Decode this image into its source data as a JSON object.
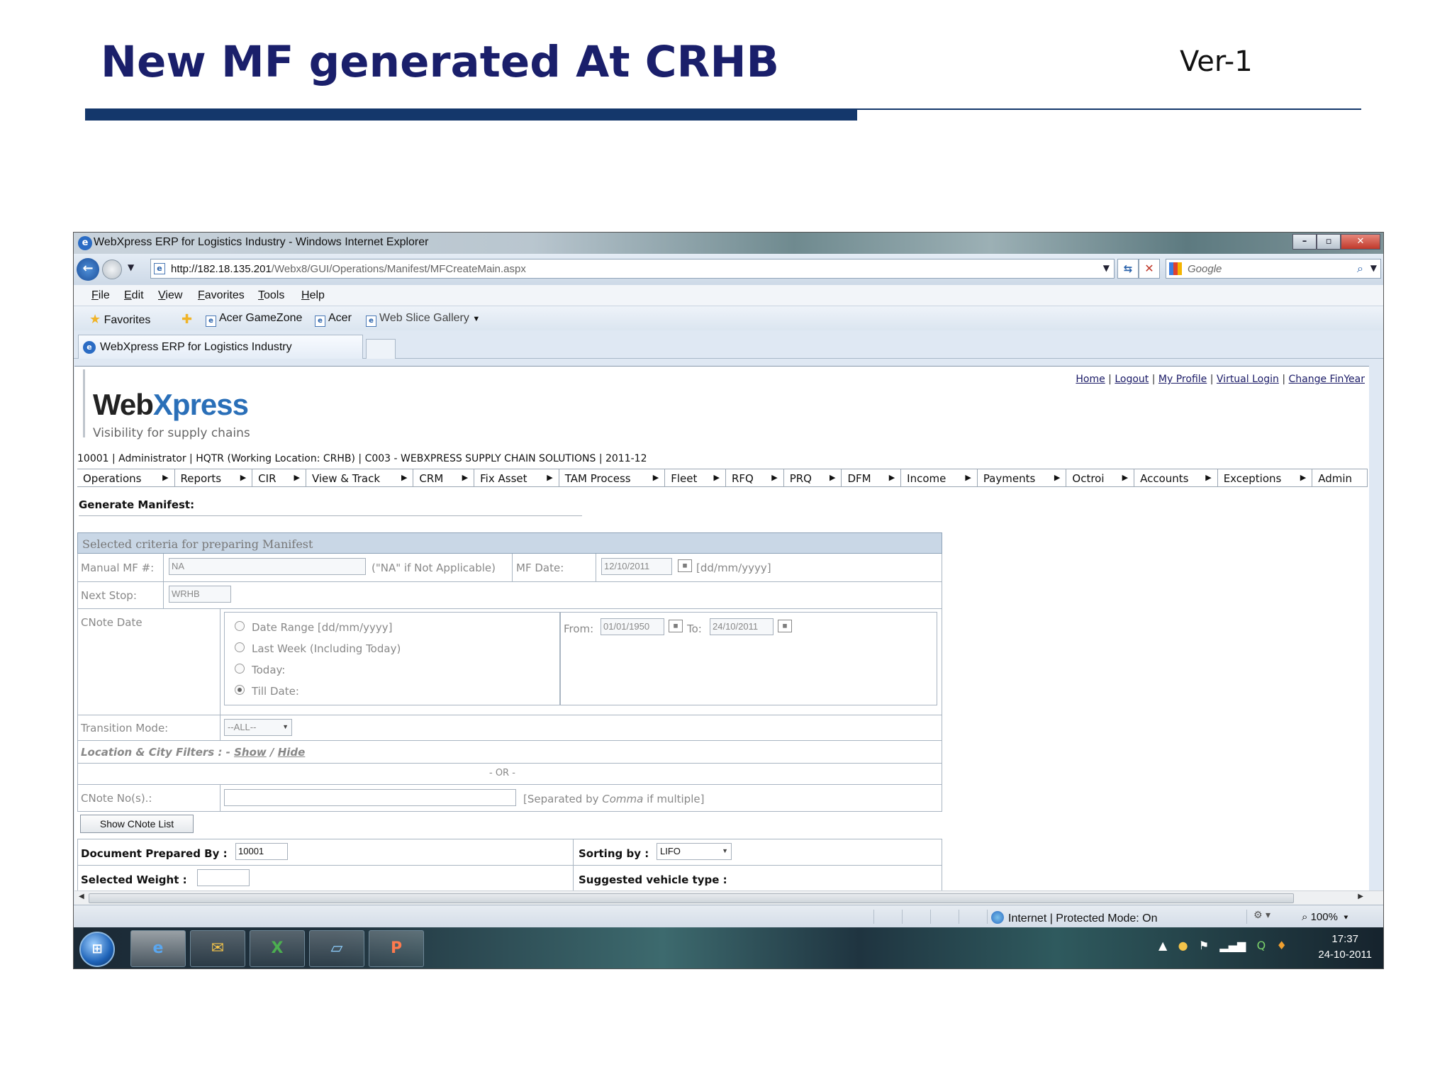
{
  "slide": {
    "title": "New MF generated At CRHB",
    "version": "Ver-1"
  },
  "browser": {
    "window_title": "WebXpress ERP for Logistics Industry - Windows Internet Explorer",
    "url_host": "http://182.18.135.201",
    "url_path": "/Webx8/GUI/Operations/Manifest/MFCreateMain.aspx",
    "search_placeholder": "Google",
    "menu": [
      "File",
      "Edit",
      "View",
      "Favorites",
      "Tools",
      "Help"
    ],
    "favorites_label": "Favorites",
    "fav_links": [
      "Acer GameZone",
      "Acer",
      "Web Slice Gallery"
    ],
    "tab_title": "WebXpress ERP for Logistics Industry",
    "status_zone": "Internet | Protected Mode: On",
    "zoom": "100%"
  },
  "page": {
    "top_links": [
      "Home",
      "Logout",
      "My Profile",
      "Virtual Login",
      "Change FinYear"
    ],
    "logo_web": "Web",
    "logo_x": "X",
    "logo_press": "press",
    "tagline": "Visibility for supply chains",
    "user_line": "10001 | Administrator | HQTR (Working Location: CRHB) | C003 - WEBXPRESS SUPPLY CHAIN SOLUTIONS | 2011-12",
    "nav": [
      {
        "label": "Operations",
        "arrow": true
      },
      {
        "label": "Reports",
        "arrow": true
      },
      {
        "label": "CIR",
        "arrow": true
      },
      {
        "label": "View & Track",
        "arrow": true
      },
      {
        "label": "CRM",
        "arrow": true
      },
      {
        "label": "Fix Asset",
        "arrow": true
      },
      {
        "label": "TAM Process",
        "arrow": true
      },
      {
        "label": "Fleet",
        "arrow": true
      },
      {
        "label": "RFQ",
        "arrow": true
      },
      {
        "label": "PRQ",
        "arrow": true
      },
      {
        "label": "DFM",
        "arrow": true
      },
      {
        "label": "Income",
        "arrow": true
      },
      {
        "label": "Payments",
        "arrow": true
      },
      {
        "label": "Octroi",
        "arrow": true
      },
      {
        "label": "Accounts",
        "arrow": true
      },
      {
        "label": "Exceptions",
        "arrow": true
      },
      {
        "label": "Admin",
        "arrow": false
      }
    ],
    "section_title": "Generate Manifest:",
    "form": {
      "header": "Selected criteria for preparing Manifest",
      "manual_mf_label": "Manual MF #:",
      "manual_mf_value": "NA",
      "manual_mf_hint": "(\"NA\" if Not Applicable)",
      "mf_date_label": "MF Date:",
      "mf_date_value": "12/10/2011",
      "mf_date_hint": "[dd/mm/yyyy]",
      "next_stop_label": "Next Stop:",
      "next_stop_value": "WRHB",
      "cnote_date_label": "CNote Date",
      "radio_options": [
        {
          "label": "Date Range [dd/mm/yyyy]",
          "checked": false
        },
        {
          "label": "Last Week (Including Today)",
          "checked": false
        },
        {
          "label": "Today:",
          "checked": false
        },
        {
          "label": "Till Date:",
          "checked": true
        }
      ],
      "from_label": "From:",
      "from_value": "01/01/1950",
      "to_label": "To:",
      "to_value": "24/10/2011",
      "transition_label": "Transition Mode:",
      "transition_value": "--ALL--",
      "filters_label": "Location & City Filters : -",
      "filters_show": "Show",
      "filters_sep": "/",
      "filters_hide": "Hide",
      "or_text": "- OR -",
      "cnote_no_label": "CNote No(s).:",
      "cnote_no_value": "",
      "cnote_no_hint_pre": "[Separated by",
      "cnote_no_hint_em": "Comma",
      "cnote_no_hint_post": "if multiple]",
      "show_list_button": "Show CNote List",
      "prepared_by_label": "Document Prepared By :",
      "prepared_by_value": "10001",
      "sorting_label": "Sorting by :",
      "sorting_value": "LIFO",
      "weight_label": "Selected Weight :",
      "weight_value": "",
      "vehicle_label": "Suggested vehicle type :"
    }
  },
  "taskbar": {
    "apps": [
      "ie",
      "outlook",
      "excel",
      "paint",
      "powerpoint"
    ],
    "time": "17:37",
    "date": "24-10-2011"
  }
}
